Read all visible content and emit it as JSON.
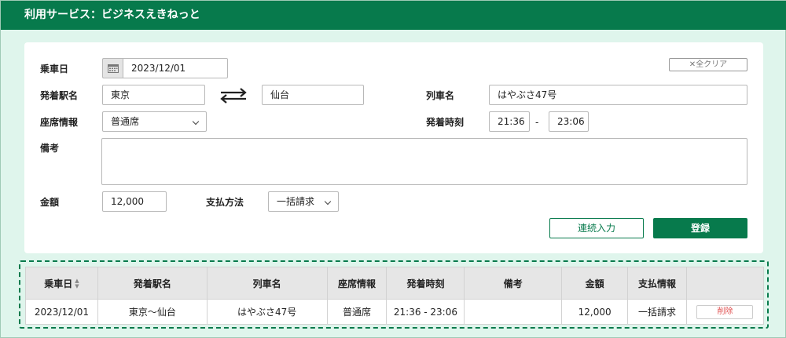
{
  "header": {
    "title": "利用サービス：ビジネスえきねっと"
  },
  "form": {
    "clear_label": "全クリア",
    "boarding_date": {
      "label": "乗車日",
      "value": "2023/12/01"
    },
    "stations": {
      "label": "発着駅名",
      "from": "東京",
      "to": "仙台"
    },
    "train_name": {
      "label": "列車名",
      "value": "はやぶさ47号"
    },
    "seat_info": {
      "label": "座席情報",
      "value": "普通席"
    },
    "times": {
      "label": "発着時刻",
      "depart": "21:36",
      "separator": "-",
      "arrive": "23:06"
    },
    "remarks": {
      "label": "備考",
      "value": ""
    },
    "amount": {
      "label": "金額",
      "value": "12,000"
    },
    "payment": {
      "label": "支払方法",
      "value": "一括請求"
    },
    "continue_label": "連続入力",
    "register_label": "登録"
  },
  "table": {
    "headers": {
      "date": "乗車日",
      "stations": "発着駅名",
      "train": "列車名",
      "seat": "座席情報",
      "times": "発着時刻",
      "remarks": "備考",
      "amount": "金額",
      "payment": "支払情報"
    },
    "rows": [
      {
        "date": "2023/12/01",
        "stations": "東京〜仙台",
        "train": "はやぶさ47号",
        "seat": "普通席",
        "times": "21:36 - 23:06",
        "remarks": "",
        "amount": "12,000",
        "payment": "一括請求",
        "delete_label": "削除"
      }
    ]
  },
  "colors": {
    "brand": "#077a4c",
    "background": "#dff5ec",
    "delete": "#e05050"
  }
}
